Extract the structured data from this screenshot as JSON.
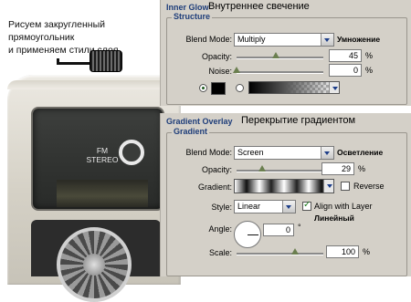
{
  "caption": {
    "line1": "Рисуем закругленный",
    "line2": "прямоугольник",
    "line3": "и применяем стили слоя"
  },
  "device": {
    "fm_label": "FM",
    "stereo_label": "STEREO"
  },
  "inner_glow": {
    "title": "Inner Glow",
    "title_ru": "Внутреннее свечение",
    "structure_label": "Structure",
    "blend_mode_label": "Blend Mode:",
    "blend_mode_value": "Multiply",
    "blend_mode_ru": "Умножение",
    "opacity_label": "Opacity:",
    "opacity_value": "45",
    "opacity_unit": "%",
    "opacity_level": 0.45,
    "noise_label": "Noise:",
    "noise_value": "0",
    "noise_unit": "%",
    "noise_level": 0.0,
    "color_swatch": "#000000"
  },
  "gradient_overlay": {
    "title": "Gradient Overlay",
    "title_ru": "Перекрытие градиентом",
    "gradient_label": "Gradient",
    "blend_mode_label": "Blend Mode:",
    "blend_mode_value": "Screen",
    "blend_mode_ru": "Осветление",
    "opacity_label": "Opacity:",
    "opacity_value": "29",
    "opacity_unit": "%",
    "opacity_level": 0.29,
    "gradient_row_label": "Gradient:",
    "reverse_label": "Reverse",
    "style_label": "Style:",
    "style_value": "Linear",
    "style_ru": "Линейный",
    "align_label": "Align with Layer",
    "angle_label": "Angle:",
    "angle_value": "0",
    "angle_unit": "°",
    "scale_label": "Scale:",
    "scale_value": "100",
    "scale_unit": "%",
    "scale_level": 0.67
  },
  "colors": {
    "section_title": "#1f3e7a",
    "panel_bg": "#d4d0c8"
  }
}
